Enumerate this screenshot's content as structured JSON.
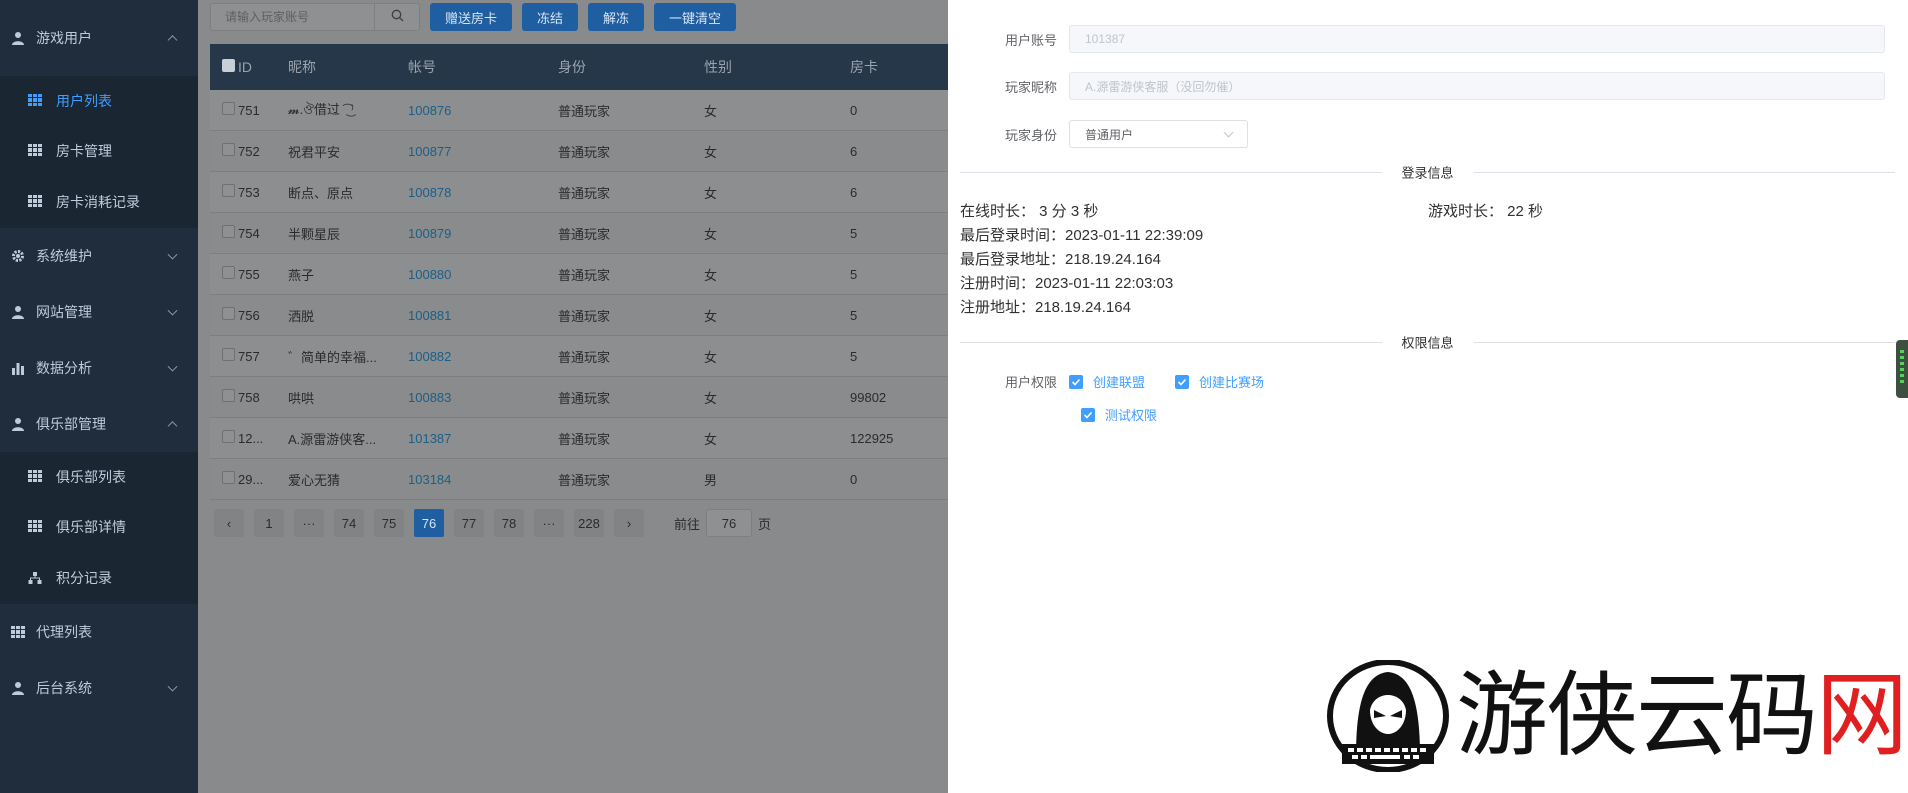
{
  "sidebar": {
    "groups": [
      {
        "label": "游戏用户",
        "icon": "user-icon",
        "expanded": true,
        "children": [
          {
            "label": "用户列表",
            "active": true
          },
          {
            "label": "房卡管理",
            "active": false
          },
          {
            "label": "房卡消耗记录",
            "active": false
          }
        ]
      },
      {
        "label": "系统维护",
        "icon": "gear-icon",
        "expanded": false
      },
      {
        "label": "网站管理",
        "icon": "user-icon",
        "expanded": false
      },
      {
        "label": "数据分析",
        "icon": "bar-chart-icon",
        "expanded": false
      },
      {
        "label": "俱乐部管理",
        "icon": "user-icon",
        "expanded": true,
        "children": [
          {
            "label": "俱乐部列表",
            "active": false
          },
          {
            "label": "俱乐部详情",
            "active": false
          },
          {
            "label": "积分记录",
            "active": false
          }
        ]
      },
      {
        "label": "代理列表",
        "icon": "grid-icon",
        "expanded": null
      },
      {
        "label": "后台系统",
        "icon": "user-icon",
        "expanded": false
      }
    ]
  },
  "toolbar": {
    "search_placeholder": "请输入玩家账号",
    "btn_gift": "赠送房卡",
    "btn_freeze": "冻结",
    "btn_unfreeze": "解冻",
    "btn_clear": "一键清空"
  },
  "table": {
    "headers": [
      "ID",
      "昵称",
      "帐号",
      "身份",
      "性别",
      "房卡"
    ],
    "rows": [
      {
        "id": "751",
        "nick": "𝓶.ঔ借过 ͡ ͜ ⁾",
        "account": "100876",
        "role": "普通玩家",
        "sex": "女",
        "card": "0"
      },
      {
        "id": "752",
        "nick": "祝君平安",
        "account": "100877",
        "role": "普通玩家",
        "sex": "女",
        "card": "6"
      },
      {
        "id": "753",
        "nick": "断点、原点",
        "account": "100878",
        "role": "普通玩家",
        "sex": "女",
        "card": "6"
      },
      {
        "id": "754",
        "nick": "半颗星辰",
        "account": "100879",
        "role": "普通玩家",
        "sex": "女",
        "card": "5"
      },
      {
        "id": "755",
        "nick": "燕子",
        "account": "100880",
        "role": "普通玩家",
        "sex": "女",
        "card": "5"
      },
      {
        "id": "756",
        "nick": "洒脱",
        "account": "100881",
        "role": "普通玩家",
        "sex": "女",
        "card": "5"
      },
      {
        "id": "757",
        "nick": "゛简单的幸福...",
        "account": "100882",
        "role": "普通玩家",
        "sex": "女",
        "card": "5"
      },
      {
        "id": "758",
        "nick": "哄哄",
        "account": "100883",
        "role": "普通玩家",
        "sex": "女",
        "card": "99802"
      },
      {
        "id": "12...",
        "nick": "A.源雷游侠客...",
        "account": "101387",
        "role": "普通玩家",
        "sex": "女",
        "card": "122925"
      },
      {
        "id": "29...",
        "nick": "爱心无猜",
        "account": "103184",
        "role": "普通玩家",
        "sex": "男",
        "card": "0"
      }
    ]
  },
  "pager": {
    "prev": "‹",
    "pages": [
      "1",
      "···",
      "74",
      "75",
      "76",
      "77",
      "78",
      "···",
      "228"
    ],
    "active": "76",
    "next": "›",
    "goto_prefix": "前往",
    "goto_value": "76",
    "goto_suffix": "页"
  },
  "drawer": {
    "account_label": "用户账号",
    "account_value": "101387",
    "nick_label": "玩家昵称",
    "nick_value": "A.源雷游侠客服（没回勿催）",
    "role_label": "玩家身份",
    "role_value": "普通用户",
    "login_section": "登录信息",
    "online_time": "在线时长： 3 分 3 秒",
    "game_time": "游戏时长： 22 秒",
    "last_login_time": "最后登录时间：2023-01-11 22:39:09",
    "last_login_addr": "最后登录地址：218.19.24.164",
    "reg_time": "注册时间：2023-01-11 22:03:03",
    "reg_addr": "注册地址：218.19.24.164",
    "perm_section": "权限信息",
    "perm_label": "用户权限",
    "perms": [
      "创建联盟",
      "创建比赛场",
      "测试权限"
    ]
  },
  "watermark": {
    "text_black": "游侠云码",
    "text_red": "网"
  },
  "colors": {
    "sidebar_bg": "#1f2d3d",
    "accent": "#409eff",
    "logo_red": "#e02020"
  }
}
